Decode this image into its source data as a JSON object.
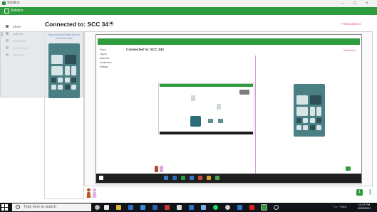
{
  "window": {
    "title": "Solstice",
    "minimize": "–",
    "maximize": "□",
    "close": "×"
  },
  "brand": {
    "label": "Solstice",
    "accent": "#2e9b3e"
  },
  "sidebar": {
    "items": [
      {
        "label": "Share",
        "icon": "share-icon"
      },
      {
        "label": "Layout",
        "icon": "layout-icon",
        "active": true
      },
      {
        "label": "Moderate",
        "icon": "people-icon"
      },
      {
        "label": "Conference",
        "icon": "camera-icon"
      },
      {
        "label": "Settings",
        "icon": "gear-icon"
      }
    ]
  },
  "header": {
    "connected_title": "Connected to: SCC 342",
    "speaker_icon": "speaker-icon",
    "disconnect_label": "Disconnect"
  },
  "drop_hint": "Drag and drop items here to hide from view",
  "remote": {
    "heading": "Connected to: SCC 342",
    "disconnect_label": "Disconnect",
    "side_items": [
      "Share",
      "Layout",
      "Moderate",
      "Conference",
      "Settings"
    ]
  },
  "footer": {
    "chip_label": "1",
    "more_icon": "more-vertical-icon"
  },
  "taskbar": {
    "search_placeholder": "Type here to search",
    "time": "12:37 PM",
    "date": "12/28/2021",
    "tray_lang": "ENG"
  }
}
